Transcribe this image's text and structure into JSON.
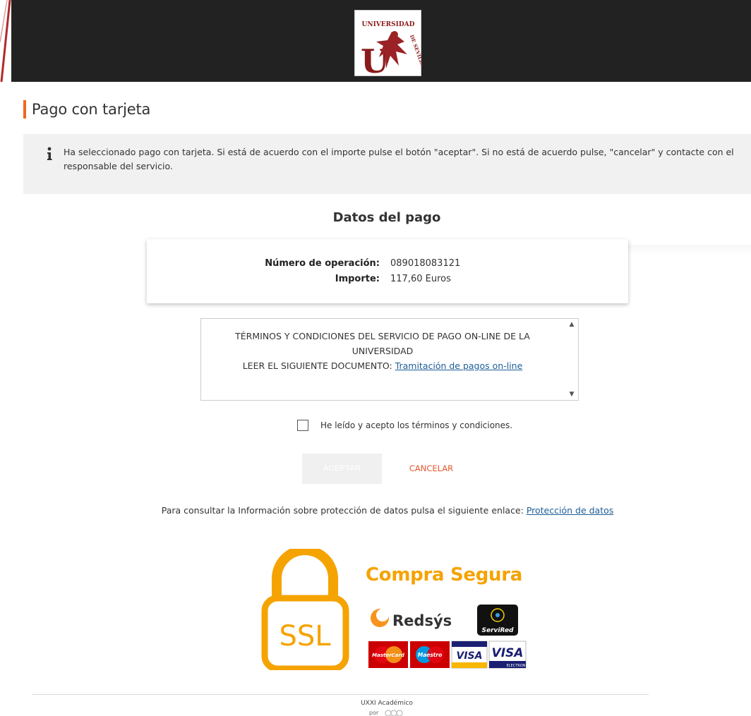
{
  "header": {
    "logo": {
      "name": "Universidad de Sevilla",
      "text_top": "UNIVERSIDAD",
      "text_right": "DE SEVILLA",
      "monogram": "U"
    }
  },
  "page": {
    "title": "Pago con tarjeta",
    "info_icon": "info-icon",
    "info_text": "Ha seleccionado pago con tarjeta. Si está de acuerdo con el importe pulse el botón \"aceptar\". Si no está de acuerdo pulse, \"cancelar\" y contacte con el responsable del servicio."
  },
  "payment": {
    "section_title": "Datos del pago",
    "operation_label": "Número de operación:",
    "operation_value": "089018083121",
    "amount_label": "Importe:",
    "amount_value": "117,60 Euros"
  },
  "terms": {
    "line1": "TÉRMINOS Y CONDICIONES DEL SERVICIO DE PAGO ON-LINE DE LA",
    "line2": "UNIVERSIDAD",
    "line3_prefix": "LEER EL SIGUIENTE DOCUMENTO: ",
    "line3_link": "Tramitación de pagos on-line",
    "checkbox_label": "He leído y acepto los términos y condiciones."
  },
  "actions": {
    "accept_label": "ACEPTAR",
    "cancel_label": "CANCELAR"
  },
  "privacy": {
    "text": "Para consultar la Información sobre protección de datos pulsa el siguiente enlace: ",
    "link": "Protección de datos"
  },
  "secure": {
    "ssl_label": "SSL",
    "compra_label": "Compra Segura",
    "redsys_label": "Redsýs",
    "servired_label": "ServiRed",
    "mastercard_label": "MasterCard",
    "maestro_label": "Maestro",
    "visa_label": "VISA",
    "visa_electron_label": "VISA",
    "electron_label": "ELECTRON"
  },
  "footer": {
    "product": "UXXI Académico",
    "by": "por"
  },
  "colors": {
    "accent": "#f26522",
    "header_bg": "#222222",
    "info_bg": "#f1f1f1",
    "link": "#1d5d97",
    "cancel": "#e4572e",
    "ssl_orange": "#f5a300"
  }
}
